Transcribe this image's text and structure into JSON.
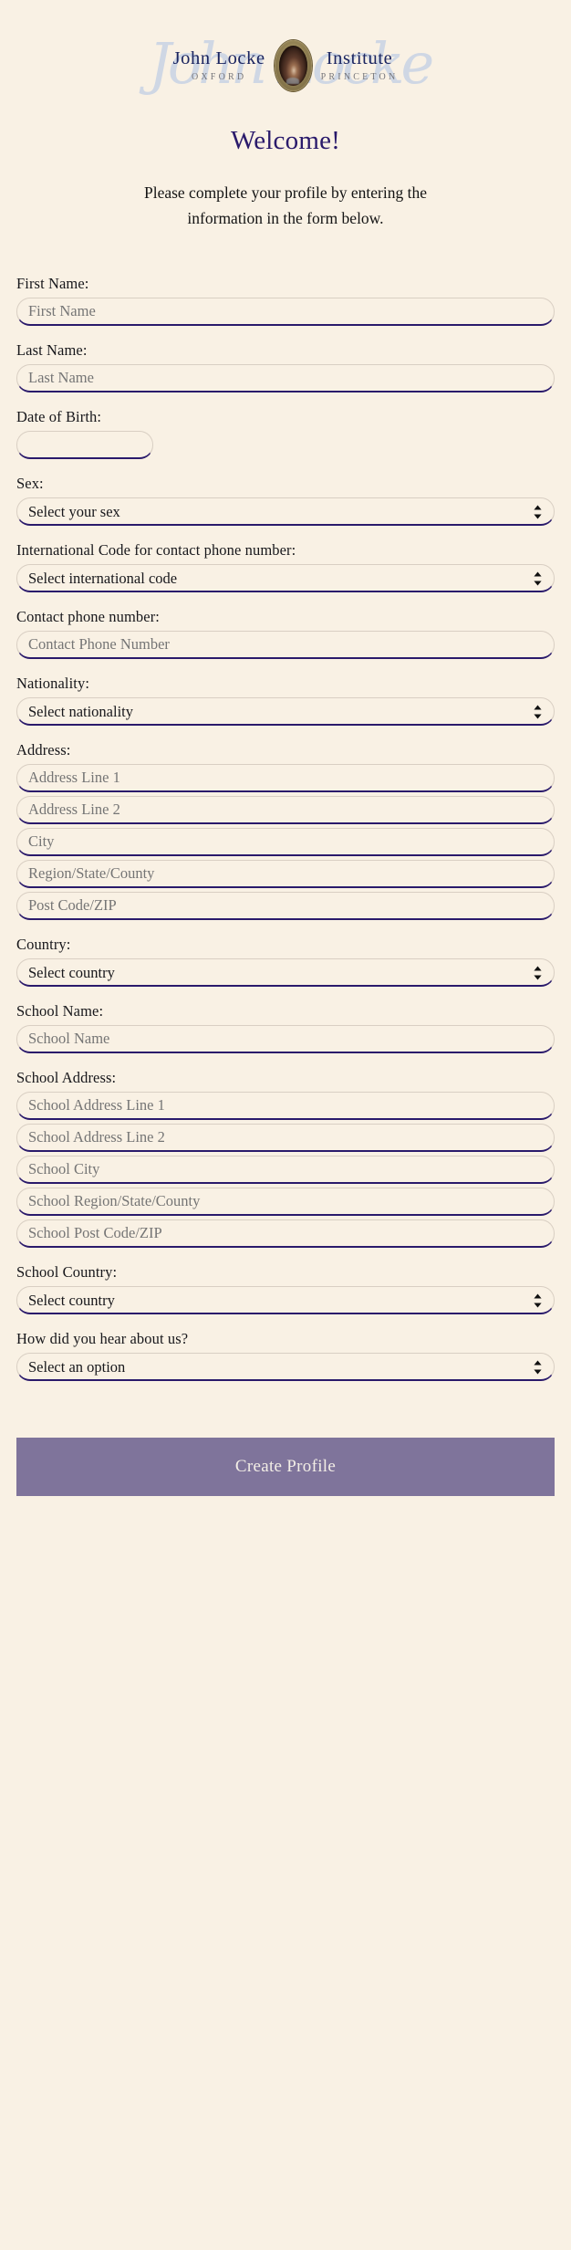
{
  "brand": {
    "name_left": "John Locke",
    "campus_left": "OXFORD",
    "name_right": "Institute",
    "campus_right": "PRINCETON",
    "watermark": "John Locke",
    "medallion_alt": "portrait-medallion",
    "navy": "#1b2560",
    "gray": "#75757a",
    "watermark_color": "#c8d3e4"
  },
  "header": {
    "title": "Welcome!",
    "intro": "Please complete your profile by entering the information in the form below.",
    "title_color": "#2a1a6b"
  },
  "form": {
    "first_name": {
      "label": "First Name:",
      "placeholder": "First Name",
      "value": ""
    },
    "last_name": {
      "label": "Last Name:",
      "placeholder": "Last Name",
      "value": ""
    },
    "date_of_birth": {
      "label": "Date of Birth:",
      "placeholder": "",
      "value": ""
    },
    "sex": {
      "label": "Sex:",
      "selected": "Select your sex"
    },
    "intl_code": {
      "label": "International Code for contact phone number:",
      "selected": "Select international code"
    },
    "phone": {
      "label": "Contact phone number:",
      "placeholder": "Contact Phone Number",
      "value": ""
    },
    "nationality": {
      "label": "Nationality:",
      "selected": "Select nationality"
    },
    "address": {
      "label": "Address:",
      "lines": [
        {
          "placeholder": "Address Line 1",
          "value": ""
        },
        {
          "placeholder": "Address Line 2",
          "value": ""
        },
        {
          "placeholder": "City",
          "value": ""
        },
        {
          "placeholder": "Region/State/County",
          "value": ""
        },
        {
          "placeholder": "Post Code/ZIP",
          "value": ""
        }
      ]
    },
    "country": {
      "label": "Country:",
      "selected": "Select country"
    },
    "school_name": {
      "label": "School Name:",
      "placeholder": "School Name",
      "value": ""
    },
    "school_address": {
      "label": "School Address:",
      "lines": [
        {
          "placeholder": "School Address Line 1",
          "value": ""
        },
        {
          "placeholder": "School Address Line 2",
          "value": ""
        },
        {
          "placeholder": "School City",
          "value": ""
        },
        {
          "placeholder": "School Region/State/County",
          "value": ""
        },
        {
          "placeholder": "School Post Code/ZIP",
          "value": ""
        }
      ]
    },
    "school_country": {
      "label": "School Country:",
      "selected": "Select country"
    },
    "referral": {
      "label": "How did you hear about us?",
      "selected": "Select an option"
    },
    "submit": {
      "label": "Create Profile",
      "background": "#7f749b",
      "text_color": "#f3eee6"
    }
  },
  "icons": {
    "select_chevrons": "chevron-up-down-icon"
  }
}
